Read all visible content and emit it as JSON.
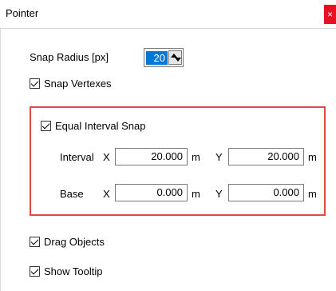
{
  "window": {
    "title": "Pointer",
    "close_label": "×"
  },
  "snap_radius": {
    "label": "Snap Radius [px]",
    "value": "20"
  },
  "snap_vertexes": {
    "label": "Snap Vertexes",
    "checked": true
  },
  "equal_interval": {
    "label": "Equal Interval Snap",
    "checked": true,
    "border_color": "#e2493f",
    "interval": {
      "label": "Interval",
      "x_label": "X",
      "x_value": "20.000",
      "x_unit": "m",
      "y_label": "Y",
      "y_value": "20.000",
      "y_unit": "m"
    },
    "base": {
      "label": "Base",
      "x_label": "X",
      "x_value": "0.000",
      "x_unit": "m",
      "y_label": "Y",
      "y_value": "0.000",
      "y_unit": "m"
    }
  },
  "drag_objects": {
    "label": "Drag Objects",
    "checked": true
  },
  "show_tooltip": {
    "label": "Show Tooltip",
    "checked": true
  },
  "colors": {
    "accent": "#0078d7",
    "close": "#e81123"
  }
}
